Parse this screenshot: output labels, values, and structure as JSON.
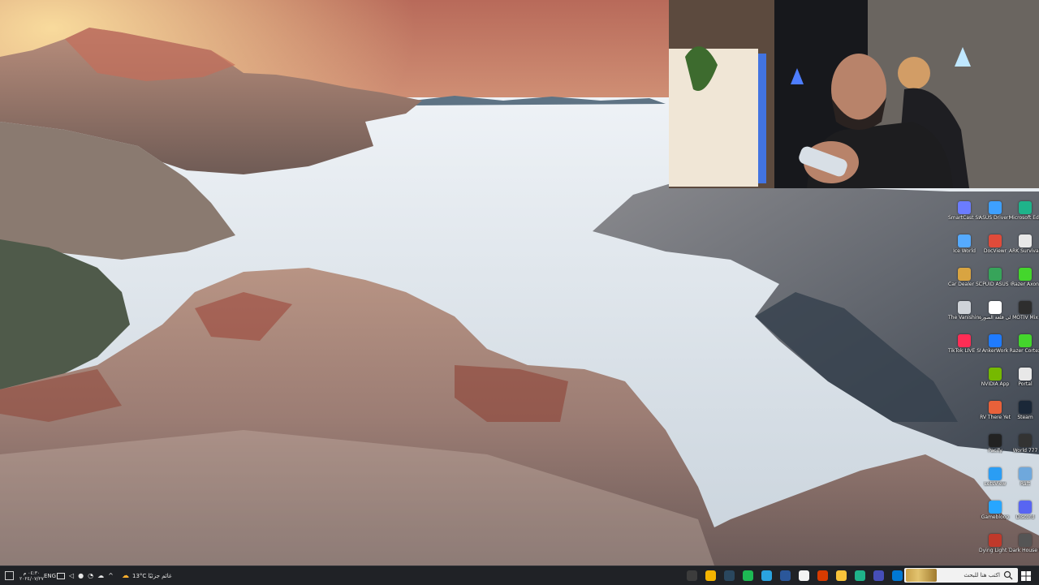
{
  "desktop": {
    "icons_col1": [
      {
        "label": "SmartCast Studio",
        "color": "#6b7cff",
        "icon": "cast-icon"
      },
      {
        "label": "Ice World",
        "color": "#55aaff",
        "icon": "globe-icon"
      },
      {
        "label": "Car Dealer Simulato...",
        "color": "#d9a441",
        "icon": "car-icon"
      },
      {
        "label": "The Vanishing ...",
        "color": "#cfd3d8",
        "icon": "ghost-icon"
      },
      {
        "label": "TikTok LIVE Studio",
        "color": "#ff2d55",
        "icon": "tiktok-icon"
      }
    ],
    "icons_col2": [
      {
        "label": "ASUS DriverHub",
        "color": "#3ea0ff",
        "icon": "driverhub-icon"
      },
      {
        "label": "DocViewr",
        "color": "#e04b3a",
        "icon": "document-icon"
      },
      {
        "label": "CPUID ASUS CPU-Z",
        "color": "#37a45a",
        "icon": "cpuz-icon"
      },
      {
        "label": "جرب إلى قلعة الصورة",
        "color": "#ffffff",
        "icon": "wand-icon"
      },
      {
        "label": "AnkerWork",
        "color": "#1f7bff",
        "icon": "ankerwork-icon"
      },
      {
        "label": "NVIDIA App",
        "color": "#76b900",
        "icon": "nvidia-icon"
      },
      {
        "label": "RV There Yet",
        "color": "#e8613a",
        "icon": "rv-icon"
      },
      {
        "label": "Pacify",
        "color": "#222222",
        "icon": "pacify-icon"
      },
      {
        "label": "LetsView",
        "color": "#2a9df4",
        "icon": "letsview-icon"
      },
      {
        "label": "Gamebloop",
        "color": "#27a6ff",
        "icon": "gameloop-icon"
      },
      {
        "label": "Dying Light The Beast",
        "color": "#c0392b",
        "icon": "dyinglight-icon"
      }
    ],
    "icons_col3": [
      {
        "label": "Microsoft Edge",
        "color": "#1fb38a",
        "icon": "edge-icon"
      },
      {
        "label": "ARK Survival Evolved",
        "color": "#e8e8e8",
        "icon": "ark-icon"
      },
      {
        "label": "Razer Axon",
        "color": "#44d62c",
        "icon": "razer-axon-icon"
      },
      {
        "label": "MOTIV Mix",
        "color": "#2e2e2e",
        "icon": "motiv-icon"
      },
      {
        "label": "Razer Cortex",
        "color": "#44d62c",
        "icon": "razer-cortex-icon"
      },
      {
        "label": "Portal",
        "color": "#e8e8e8",
        "icon": "portal-icon"
      },
      {
        "label": "Steam",
        "color": "#1b2838",
        "icon": "steam-icon"
      },
      {
        "label": "World 777",
        "color": "#333333",
        "icon": "world-icon"
      },
      {
        "label": "Raft",
        "color": "#6fa8dc",
        "icon": "raft-icon"
      },
      {
        "label": "Discord",
        "color": "#5865f2",
        "icon": "discord-icon"
      },
      {
        "label": "Dark House Prologue",
        "color": "#555555",
        "icon": "darkhouse-icon"
      }
    ]
  },
  "taskbar": {
    "search_placeholder": "اكتب هنا للبحث",
    "weather_text": "13°C غائم جزئيًا",
    "language": "ENG",
    "clock_time": "٠٤:٣٠ م",
    "clock_date": "٢٠٢٤/٠٧/٢٧",
    "pinned_apps": [
      {
        "name": "obs-icon",
        "color": "#3c3c3c"
      },
      {
        "name": "chrome-icon",
        "color": "#f4b400"
      },
      {
        "name": "steam-icon",
        "color": "#2a475e"
      },
      {
        "name": "spotify-icon",
        "color": "#1db954"
      },
      {
        "name": "telegram-icon",
        "color": "#2aa3e0"
      },
      {
        "name": "word-icon",
        "color": "#2b579a"
      },
      {
        "name": "store-icon",
        "color": "#f3f3f3"
      },
      {
        "name": "calendar-icon",
        "color": "#d83b01"
      },
      {
        "name": "file-explorer-icon",
        "color": "#f8c33a"
      },
      {
        "name": "edge-icon",
        "color": "#1fb38a"
      },
      {
        "name": "teams-icon",
        "color": "#464eb8"
      },
      {
        "name": "photos-icon",
        "color": "#0078d4"
      },
      {
        "name": "task-view-icon",
        "color": "#cfcfcf"
      }
    ]
  }
}
